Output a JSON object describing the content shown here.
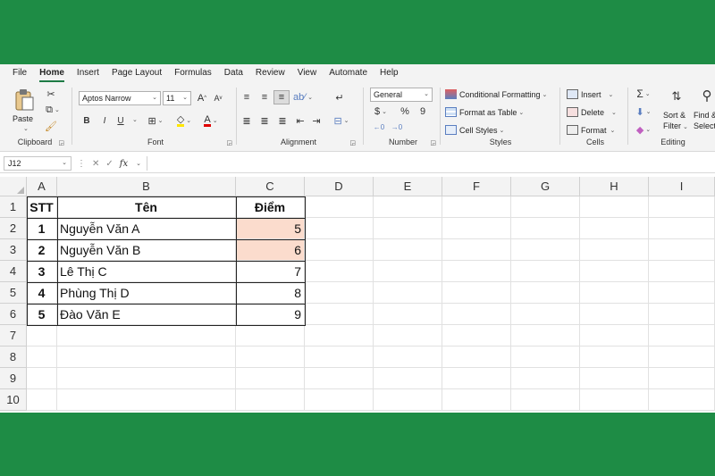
{
  "tabs": [
    "File",
    "Home",
    "Insert",
    "Page Layout",
    "Formulas",
    "Data",
    "Review",
    "View",
    "Automate",
    "Help"
  ],
  "ribbon": {
    "clipboard": {
      "paste": "Paste",
      "label": "Clipboard"
    },
    "font": {
      "name": "Aptos Narrow",
      "size": "11",
      "grow": "A",
      "shrink": "A",
      "bold": "B",
      "italic": "I",
      "underline": "U",
      "label": "Font"
    },
    "alignment": {
      "label": "Alignment"
    },
    "number": {
      "format": "General",
      "currency": "$",
      "percent": "%",
      "comma": "9",
      "label": "Number"
    },
    "styles": {
      "conditional": "Conditional Formatting",
      "format_table": "Format as Table",
      "cell_styles": "Cell Styles",
      "label": "Styles"
    },
    "cells": {
      "insert": "Insert",
      "delete": "Delete",
      "format": "Format",
      "label": "Cells"
    },
    "editing": {
      "sum": "Σ",
      "sort": "Sort &",
      "filter": "Filter",
      "find": "Find &",
      "select": "Select",
      "label": "Editing"
    }
  },
  "formula_bar": {
    "name_box": "J12",
    "fx": "fx",
    "value": ""
  },
  "columns": [
    "A",
    "B",
    "C",
    "D",
    "E",
    "F",
    "G",
    "H",
    "I"
  ],
  "rows": [
    "1",
    "2",
    "3",
    "4",
    "5",
    "6",
    "7",
    "8",
    "9",
    "10"
  ],
  "table": {
    "headers": [
      "STT",
      "Tên",
      "Điểm"
    ],
    "rows": [
      [
        "1",
        "Nguyễn Văn A",
        "5"
      ],
      [
        "2",
        "Nguyễn Văn B",
        "6"
      ],
      [
        "3",
        "Lê Thị C",
        "7"
      ],
      [
        "4",
        "Phùng Thị D",
        "8"
      ],
      [
        "5",
        "Đào Văn E",
        "9"
      ]
    ]
  },
  "colors": {
    "background": "#1e8c45",
    "accent": "#1e7b45",
    "highlight": "#fbdccd"
  }
}
